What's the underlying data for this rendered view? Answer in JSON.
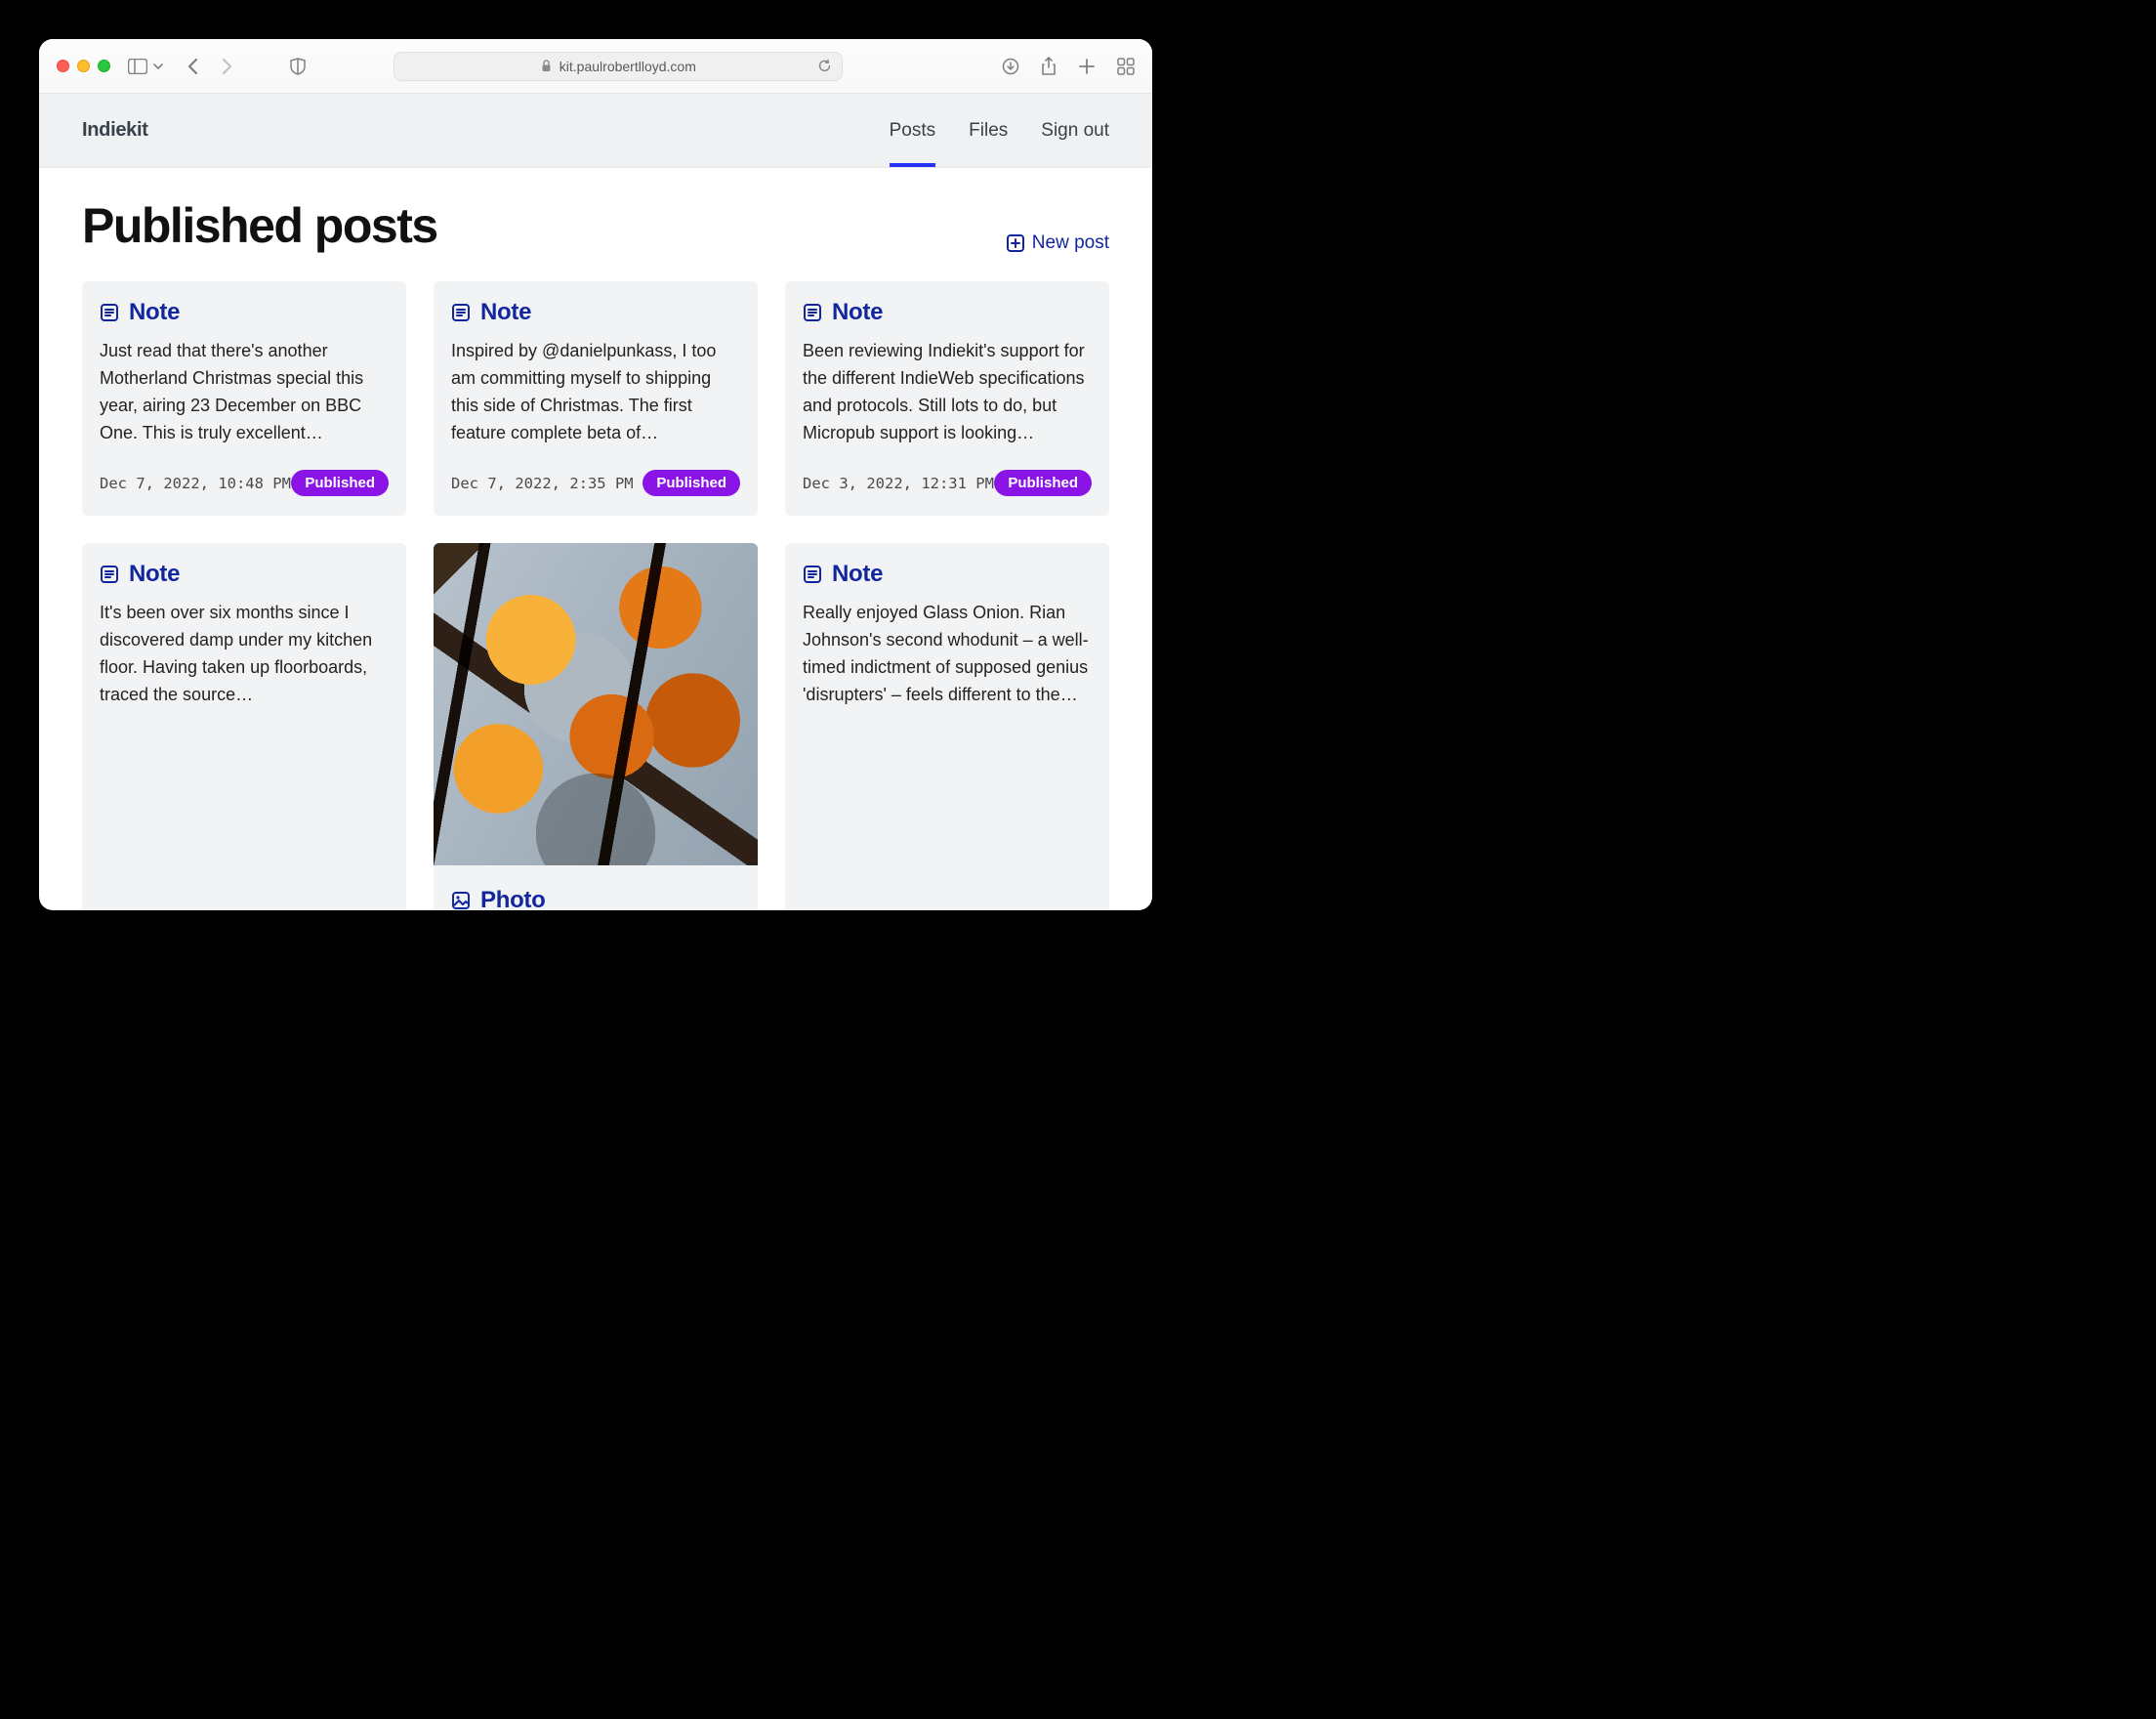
{
  "browser": {
    "url": "kit.paulrobertlloyd.com"
  },
  "header": {
    "brand": "Indiekit",
    "nav": [
      {
        "label": "Posts",
        "active": true
      },
      {
        "label": "Files",
        "active": false
      },
      {
        "label": "Sign out",
        "active": false
      }
    ]
  },
  "page": {
    "title": "Published posts",
    "new_post_label": "New post"
  },
  "posts": [
    {
      "type": "Note",
      "body": "Just read that there's another Motherland Christmas special this year, airing 23 December on BBC One. This is truly excellent…",
      "timestamp": "Dec 7, 2022, 10:48 PM",
      "status": "Published"
    },
    {
      "type": "Note",
      "body": "Inspired by @danielpunkass, I too am committing myself to shipping this side of Christmas. The first feature complete beta of…",
      "timestamp": "Dec 7, 2022, 2:35 PM",
      "status": "Published"
    },
    {
      "type": "Note",
      "body": "Been reviewing Indiekit's support for the different IndieWeb specifications and protocols. Still lots to do, but Micropub support is looking…",
      "timestamp": "Dec 3, 2022, 12:31 PM",
      "status": "Published"
    },
    {
      "type": "Note",
      "body": "It's been over six months since I discovered damp under my kitchen floor. Having taken up floorboards, traced the source…",
      "timestamp": "",
      "status": ""
    },
    {
      "type": "Photo",
      "body": "",
      "timestamp": "",
      "status": ""
    },
    {
      "type": "Note",
      "body": "Really enjoyed Glass Onion. Rian Johnson's second whodunit – a well-timed indictment of supposed genius 'disrupters' – feels different to the…",
      "timestamp": "",
      "status": ""
    }
  ]
}
